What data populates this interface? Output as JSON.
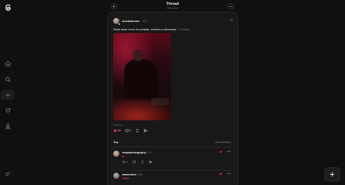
{
  "app": {
    "logo_icon": "threads-logo-icon"
  },
  "header": {
    "title": "Thread",
    "subtitle": "983 views"
  },
  "nav": {
    "items": [
      {
        "name": "home",
        "icon": "home-icon"
      },
      {
        "name": "search",
        "icon": "search-icon"
      },
      {
        "name": "create",
        "icon": "plus-icon"
      },
      {
        "name": "activity",
        "icon": "heart-icon"
      },
      {
        "name": "profile",
        "icon": "user-icon"
      }
    ],
    "menu_icon": "menu-icon"
  },
  "post": {
    "username": "alexdafmusic",
    "time": "20h",
    "text": "Якщо мене хтось не розуміє, значить я містецтво.",
    "translate_label": "Translate",
    "liked_by": "Liked by...",
    "actions": {
      "likes": "55",
      "comments": "5"
    }
  },
  "replies_header": {
    "sort_label": "Top",
    "view_activity_label": "View activity"
  },
  "replies": [
    {
      "username": "stepaphotography",
      "time": "17h",
      "text": "❤",
      "like_count": "1"
    },
    {
      "username": "stasonskie",
      "time": "18h",
      "text": "❤❤❤"
    }
  ],
  "colors": {
    "accent_like": "#e0245e",
    "panel_bg": "#181818",
    "page_bg": "#101010"
  }
}
